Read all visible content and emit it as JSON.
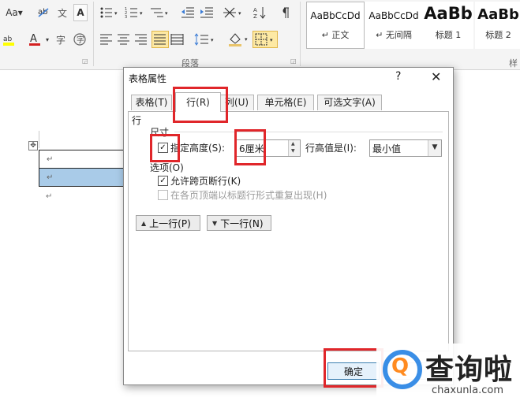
{
  "ribbon": {
    "font_size_button": "Aa▾",
    "clear_format_button": "A",
    "phonetic_button": "文",
    "char_border_button": "A",
    "highlight_button": "ab",
    "font_color_button": "A",
    "enclose_char_button": "字",
    "paragraph_group_label": "段落",
    "styles_group_label": "样",
    "styles": [
      {
        "sample": "AaBbCcDd",
        "name": "↵ 正文"
      },
      {
        "sample": "AaBbCcDd",
        "name": "↵ 无间隔"
      },
      {
        "sample": "AaBb",
        "name": "标题 1"
      },
      {
        "sample": "AaBb",
        "name": "标题 2"
      }
    ]
  },
  "document": {
    "move_handle": "✥",
    "rows": [
      "↵",
      "↵"
    ],
    "after_table_mark": "↵"
  },
  "dialog": {
    "title": "表格属性",
    "help": "?",
    "close": "✕",
    "tabs": [
      "表格(T)",
      "行(R)",
      "列(U)",
      "单元格(E)",
      "可选文字(A)"
    ],
    "active_tab": "行(R)",
    "section_label": "行",
    "size_label": "尺寸",
    "specify_height_label": "指定高度(S):",
    "specify_height_checked": "✓",
    "height_value": "6厘米",
    "height_rule_label": "行高值是(I):",
    "height_rule_value": "最小值",
    "options_label": "选项(O)",
    "allow_break_label": "允许跨页断行(K)",
    "allow_break_checked": "✓",
    "repeat_header_label": "在各页顶端以标题行形式重复出现(H)",
    "prev_row_button": "上一行(P)",
    "next_row_button": "下一行(N)",
    "ok_button": "确定"
  },
  "watermark": {
    "brand": "查询啦",
    "url": "chaxunla.com",
    "colors": {
      "ring": "#3a8ee6",
      "q": "#ff8a1f"
    }
  },
  "highlight_color": "#e0262a"
}
